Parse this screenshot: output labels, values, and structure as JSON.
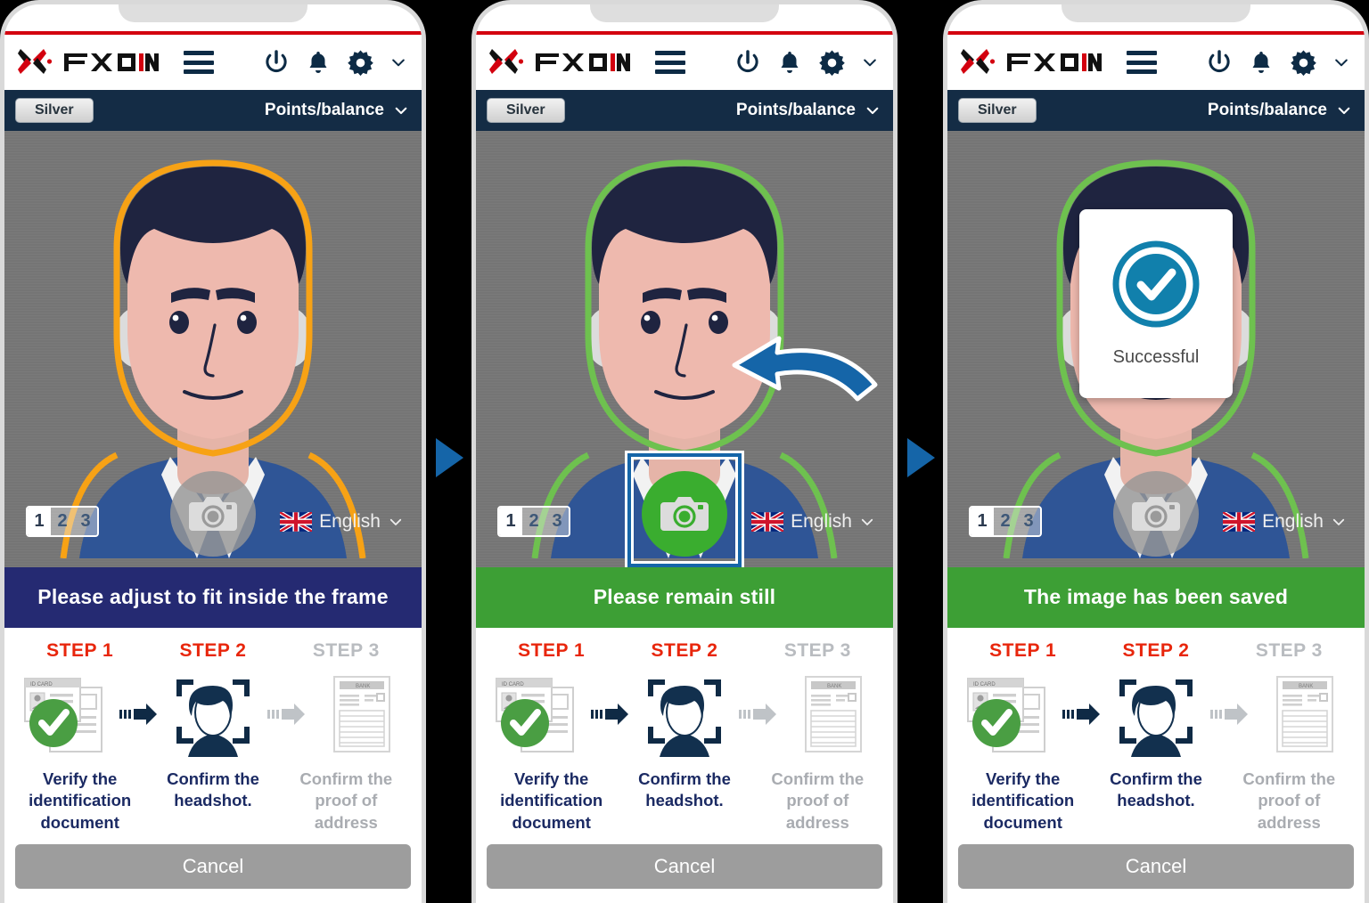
{
  "brand": {
    "logo_text": "FXON",
    "accent_red": "#d3000f",
    "navy": "#142c45"
  },
  "header": {
    "menu_icon": "hamburger-icon",
    "power_icon": "power-icon",
    "bell_icon": "bell-icon",
    "gear_icon": "gear-icon",
    "chevron_icon": "chevron-down-icon"
  },
  "subbar": {
    "tier_label": "Silver",
    "points_label": "Points/balance",
    "points_chevron": "chevron-down-icon"
  },
  "viewport": {
    "pager": [
      "1",
      "2",
      "3"
    ],
    "pager_active_index": 0,
    "language_label": "English",
    "language_flag": "uk-flag-icon",
    "language_chevron": "chevron-down-icon",
    "camera_icon": "camera-icon"
  },
  "panels": [
    {
      "id": "panel-adjust",
      "banner_text": "Please adjust to fit inside the frame",
      "banner_color": "#252a72",
      "banner_style": "navy",
      "face_outline_color": "#f7a215",
      "shutter_state": "idle",
      "shutter_color": "#969696",
      "show_cue_arrow": false,
      "show_success_dialog": false
    },
    {
      "id": "panel-still",
      "banner_text": "Please remain still",
      "banner_color": "#3d9f35",
      "banner_style": "green",
      "face_outline_color": "#6ec14f",
      "shutter_state": "armed",
      "shutter_color": "#3aad2f",
      "show_cue_arrow": true,
      "show_success_dialog": false
    },
    {
      "id": "panel-saved",
      "banner_text": "The image has been saved",
      "banner_color": "#3d9f35",
      "banner_style": "green",
      "face_outline_color": "#6ec14f",
      "shutter_state": "idle",
      "shutter_color": "#969696",
      "show_cue_arrow": false,
      "show_success_dialog": true
    }
  ],
  "success_dialog": {
    "text": "Successful",
    "icon": "check-circle-icon",
    "icon_color": "#1180ac"
  },
  "steps": {
    "titles": [
      "STEP 1",
      "STEP 2",
      "STEP 3"
    ],
    "labels": [
      "Verify the identification document",
      "Confirm the headshot.",
      "Confirm the proof of address"
    ],
    "icons": [
      "id-card-checked-icon",
      "face-scan-icon",
      "bank-statement-icon"
    ],
    "icon_doc_title": "ID CARD",
    "icon_bank_title": "BANK",
    "active_color": "#e8260c",
    "inactive_color": "#b9bcc0",
    "label_active_color": "#1b2a63",
    "label_inactive_color": "#a9acb1",
    "completed_index": 0,
    "current_index": 1
  },
  "footer": {
    "cancel_label": "Cancel"
  },
  "separators": {
    "arrow_icon": "play-triangle-icon",
    "arrow_color": "#1565a8",
    "count": 2
  }
}
